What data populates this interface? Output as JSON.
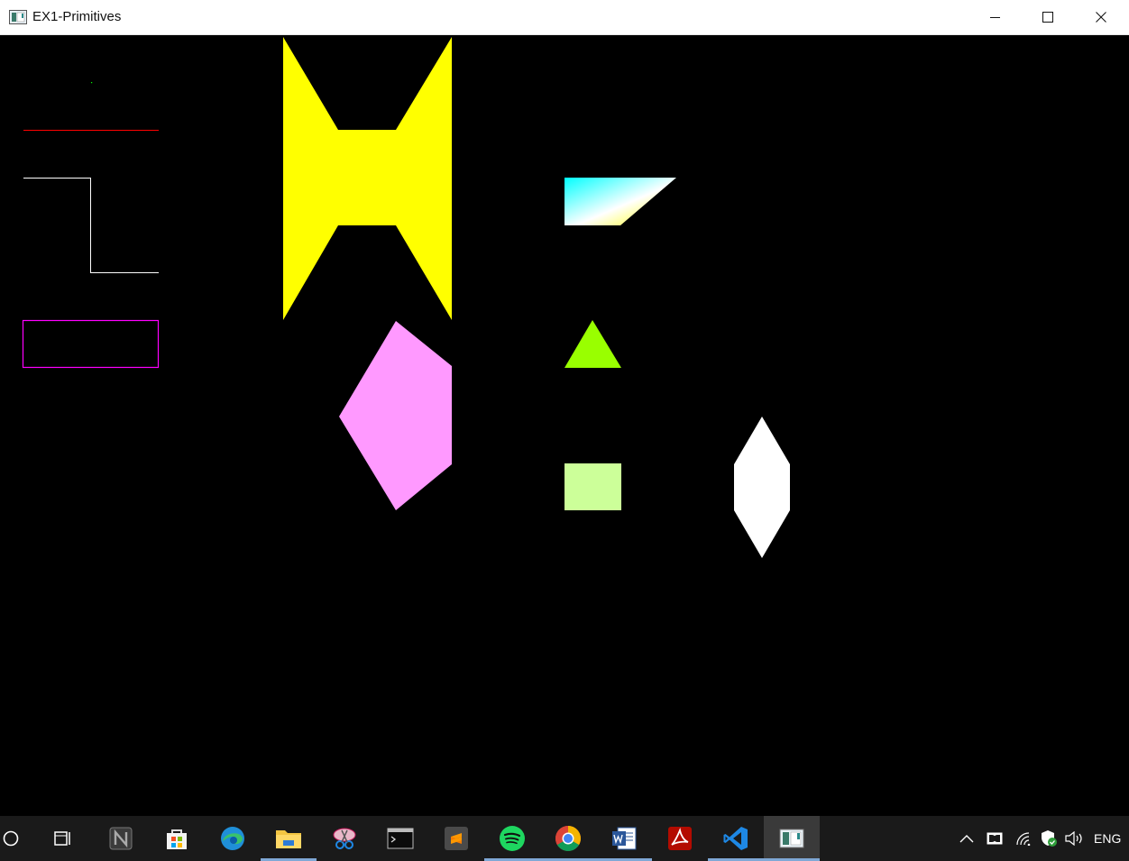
{
  "window": {
    "title": "EX1-Primitives",
    "controls": [
      "minimize-icon",
      "maximize-icon",
      "close-icon"
    ]
  },
  "canvas": {
    "background": "#000000",
    "primitives": [
      {
        "kind": "point",
        "color": "#00ff00"
      },
      {
        "kind": "line",
        "color": "#ff0000"
      },
      {
        "kind": "line-strip",
        "color": "#ffffff"
      },
      {
        "kind": "line-loop",
        "color": "#ff00ff"
      },
      {
        "kind": "quad-strip",
        "color": "#ffff00"
      },
      {
        "kind": "polygon",
        "color": "#ff99ff"
      },
      {
        "kind": "quad",
        "gradient": [
          "#00ffff",
          "#ffffff",
          "#ffff00"
        ]
      },
      {
        "kind": "triangle",
        "color": "#99ff00"
      },
      {
        "kind": "quad",
        "color": "#ccff99"
      },
      {
        "kind": "polygon",
        "color": "#ffffff"
      }
    ]
  },
  "taskbar": {
    "items": [
      {
        "name": "search-icon"
      },
      {
        "name": "task-view-icon"
      },
      {
        "name": "notion-icon"
      },
      {
        "name": "store-icon"
      },
      {
        "name": "edge-icon"
      },
      {
        "name": "file-explorer-icon",
        "running": true
      },
      {
        "name": "snipping-tool-icon"
      },
      {
        "name": "terminal-icon"
      },
      {
        "name": "sublime-text-icon"
      },
      {
        "name": "spotify-icon",
        "running": true
      },
      {
        "name": "chrome-icon",
        "running": true
      },
      {
        "name": "word-icon",
        "running": true
      },
      {
        "name": "acrobat-icon"
      },
      {
        "name": "vscode-icon",
        "running": true
      },
      {
        "name": "opengl-app-icon",
        "running": true,
        "active": true
      }
    ],
    "tray": {
      "icons": [
        "chevron-up-icon",
        "dolby-icon",
        "network-icon",
        "security-icon",
        "volume-icon"
      ],
      "language": "ENG"
    }
  }
}
